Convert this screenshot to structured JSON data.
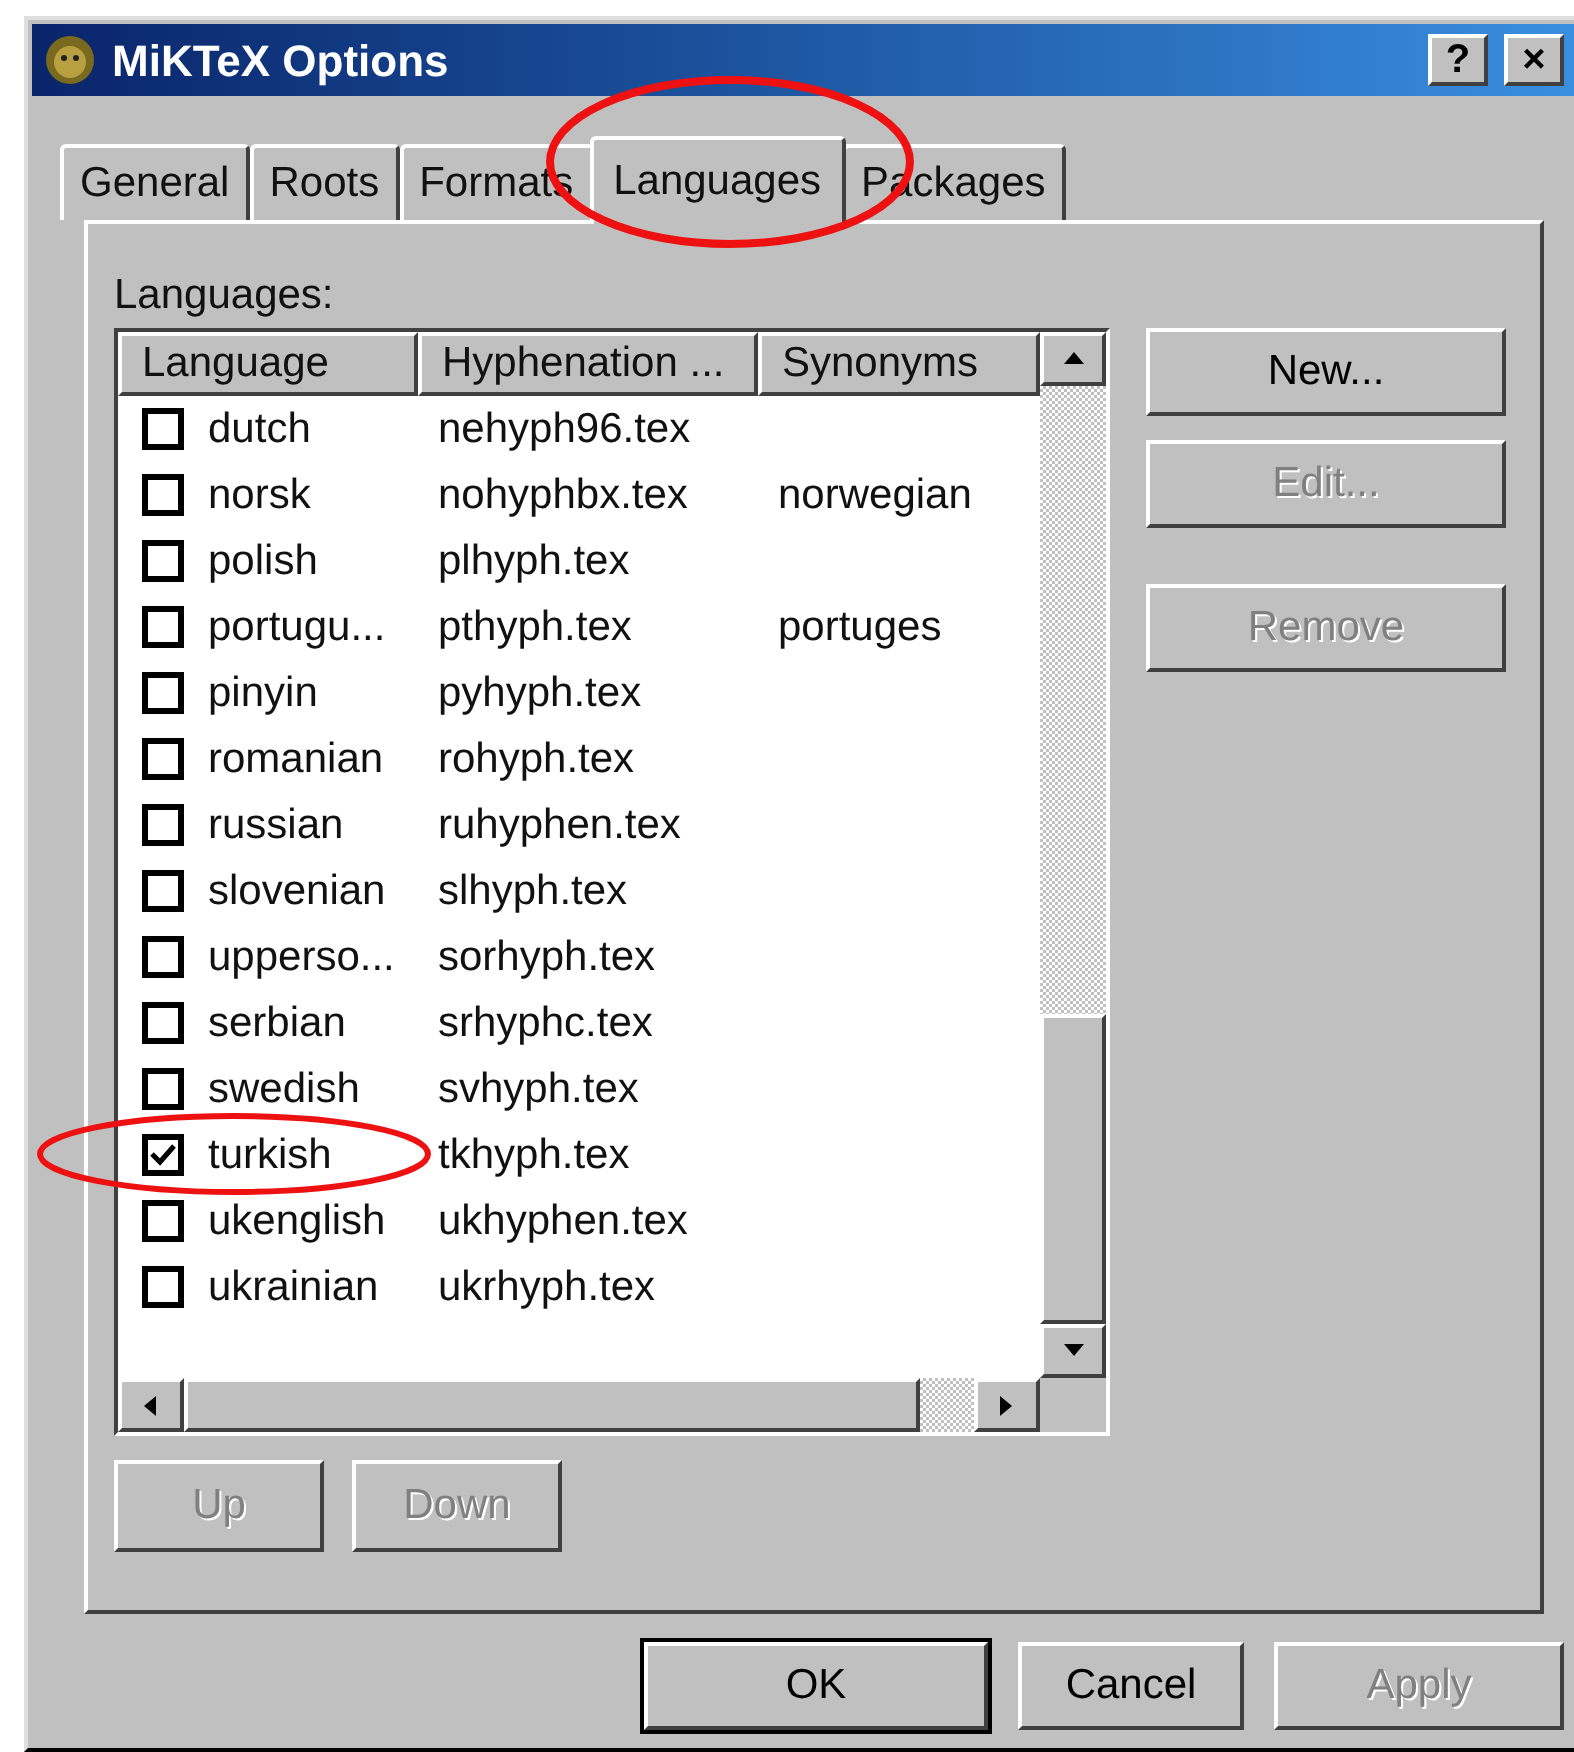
{
  "window": {
    "title": "MiKTeX Options",
    "title_buttons": [
      "?",
      "×"
    ]
  },
  "tabs": [
    {
      "label": "General",
      "selected": false
    },
    {
      "label": "Roots",
      "selected": false
    },
    {
      "label": "Formats",
      "selected": false
    },
    {
      "label": "Languages",
      "selected": true
    },
    {
      "label": "Packages",
      "selected": false
    }
  ],
  "list_label": "Languages:",
  "table": {
    "columns": [
      "Language",
      "Hyphenation ...",
      "Synonyms"
    ],
    "rows": [
      {
        "checked": false,
        "cells": [
          "dutch",
          "nehyph96.tex",
          ""
        ]
      },
      {
        "checked": false,
        "cells": [
          "norsk",
          "nohyphbx.tex",
          "norwegian"
        ]
      },
      {
        "checked": false,
        "cells": [
          "polish",
          "plhyph.tex",
          ""
        ]
      },
      {
        "checked": false,
        "cells": [
          "portugu...",
          "pthyph.tex",
          "portuges"
        ]
      },
      {
        "checked": false,
        "cells": [
          "pinyin",
          "pyhyph.tex",
          ""
        ]
      },
      {
        "checked": false,
        "cells": [
          "romanian",
          "rohyph.tex",
          ""
        ]
      },
      {
        "checked": false,
        "cells": [
          "russian",
          "ruhyphen.tex",
          ""
        ]
      },
      {
        "checked": false,
        "cells": [
          "slovenian",
          "slhyph.tex",
          ""
        ]
      },
      {
        "checked": false,
        "cells": [
          "upperso...",
          "sorhyph.tex",
          ""
        ]
      },
      {
        "checked": false,
        "cells": [
          "serbian",
          "srhyphc.tex",
          ""
        ]
      },
      {
        "checked": false,
        "cells": [
          "swedish",
          "svhyph.tex",
          ""
        ]
      },
      {
        "checked": true,
        "cells": [
          "turkish",
          "tkhyph.tex",
          ""
        ]
      },
      {
        "checked": false,
        "cells": [
          "ukenglish",
          "ukhyphen.tex",
          ""
        ]
      },
      {
        "checked": false,
        "cells": [
          "ukrainian",
          "ukrhyph.tex",
          ""
        ]
      }
    ]
  },
  "side_buttons": [
    {
      "label": "New...",
      "disabled": false
    },
    {
      "label": "Edit...",
      "disabled": true
    },
    {
      "label": "Remove",
      "disabled": true
    }
  ],
  "move_buttons": [
    {
      "label": "Up",
      "disabled": true
    },
    {
      "label": "Down",
      "disabled": true
    }
  ],
  "dialog_buttons": [
    {
      "label": "OK",
      "disabled": false,
      "default": true
    },
    {
      "label": "Cancel",
      "disabled": false,
      "default": false
    },
    {
      "label": "Apply",
      "disabled": true,
      "default": false
    }
  ]
}
